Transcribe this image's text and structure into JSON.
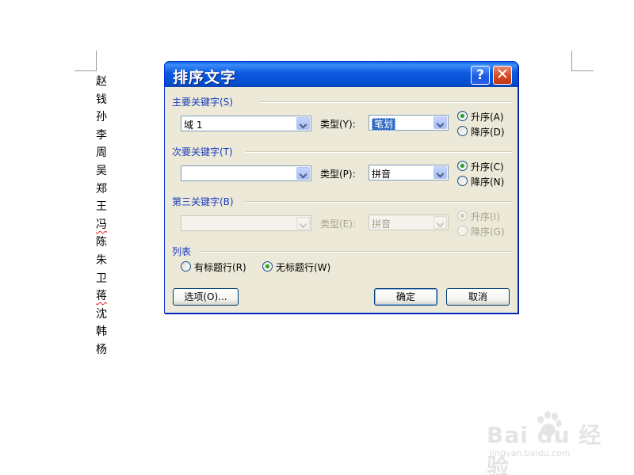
{
  "document": {
    "names": [
      {
        "text": "赵",
        "spell": false
      },
      {
        "text": "钱",
        "spell": false
      },
      {
        "text": "孙",
        "spell": false
      },
      {
        "text": "李",
        "spell": false
      },
      {
        "text": "周",
        "spell": false
      },
      {
        "text": "吴",
        "spell": false
      },
      {
        "text": "郑",
        "spell": false
      },
      {
        "text": "王",
        "spell": false
      },
      {
        "text": "冯",
        "spell": true
      },
      {
        "text": "陈",
        "spell": false
      },
      {
        "text": "朱",
        "spell": false
      },
      {
        "text": "卫",
        "spell": false
      },
      {
        "text": "蒋",
        "spell": true
      },
      {
        "text": "沈",
        "spell": false
      },
      {
        "text": "韩",
        "spell": false
      },
      {
        "text": "杨",
        "spell": false
      }
    ]
  },
  "dialog": {
    "title": "排序文字",
    "help_symbol": "?",
    "close_symbol": "✕",
    "primary": {
      "group_label": "主要关键字(S)",
      "field_value": "域 1",
      "type_label": "类型(Y):",
      "type_value": "笔划",
      "ascending": "升序(A)",
      "descending": "降序(D)",
      "selected": "ascending"
    },
    "secondary": {
      "group_label": "次要关键字(T)",
      "field_value": "",
      "type_label": "类型(P):",
      "type_value": "拼音",
      "ascending": "升序(C)",
      "descending": "降序(N)",
      "selected": "ascending"
    },
    "tertiary": {
      "group_label": "第三关键字(B)",
      "field_value": "",
      "type_label": "类型(E):",
      "type_value": "拼音",
      "ascending": "升序(I)",
      "descending": "降序(G)",
      "selected": "ascending",
      "enabled": false
    },
    "list": {
      "group_label": "列表",
      "has_header": "有标题行(R)",
      "no_header": "无标题行(W)",
      "selected": "no_header"
    },
    "buttons": {
      "options": "选项(O)...",
      "ok": "确定",
      "cancel": "取消"
    }
  },
  "watermark": {
    "brand": "Bai du 经验",
    "url": "jingyan.baidu.com"
  },
  "colors": {
    "title_bar": "#0a58e0",
    "dialog_bg": "#ece9d8",
    "group_label": "#1a3bbd",
    "selection": "#316ac5",
    "radio_dot": "#21a121"
  }
}
